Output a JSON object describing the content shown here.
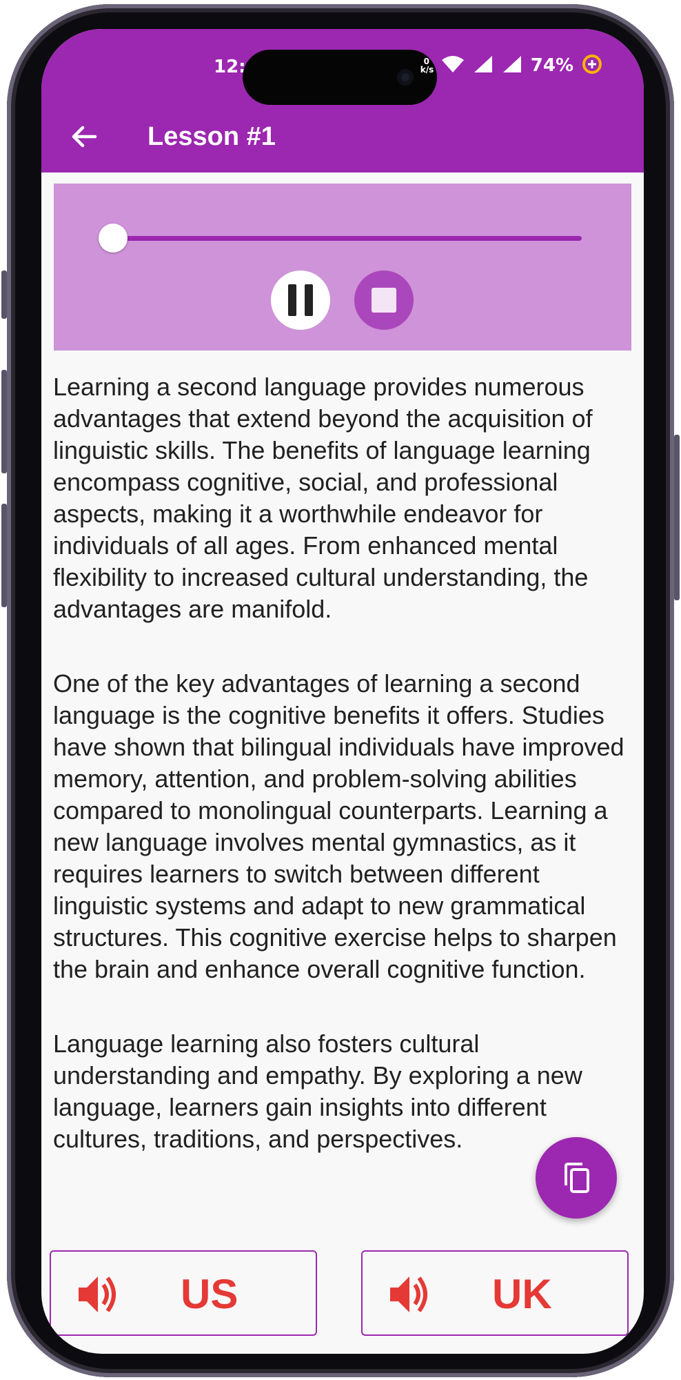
{
  "status_bar": {
    "time": "12:0",
    "network_speed": "0\nk/s",
    "battery": "74%",
    "wifi_icon": "wifi-icon",
    "signal_icon": "signal-icon",
    "battery_icon": "battery-saver-icon"
  },
  "app_bar": {
    "title": "Lesson #1",
    "back_icon": "arrow-back-icon"
  },
  "player": {
    "progress_fraction": 0.0,
    "pause_icon": "pause-icon",
    "stop_icon": "stop-icon"
  },
  "lesson": {
    "paragraphs": [
      "Learning a second language provides numerous advantages that extend beyond the acquisition of linguistic skills. The benefits of language learning encompass cognitive, social, and professional aspects, making it a worthwhile endeavor for individuals of all ages. From enhanced mental flexibility to increased cultural understanding, the advantages are manifold.",
      "One of the key advantages of learning a second language is the cognitive benefits it offers. Studies have shown that bilingual individuals have improved memory, attention, and problem-solving abilities compared to monolingual counterparts. Learning a new language involves mental gymnastics, as it requires learners to switch between different linguistic systems and adapt to new grammatical structures. This cognitive exercise helps to sharpen the brain and enhance overall cognitive function.",
      "Language learning also fosters cultural understanding and empathy. By exploring a new language, learners gain insights into different cultures, traditions, and perspectives."
    ]
  },
  "fab": {
    "icon": "copy-icon"
  },
  "accents": {
    "us_label": "US",
    "uk_label": "UK",
    "icon": "volume-up-icon",
    "color": "#e53935"
  },
  "colors": {
    "primary": "#9c27b0",
    "player_bg": "#ce93d8",
    "accent_red": "#e53935"
  }
}
